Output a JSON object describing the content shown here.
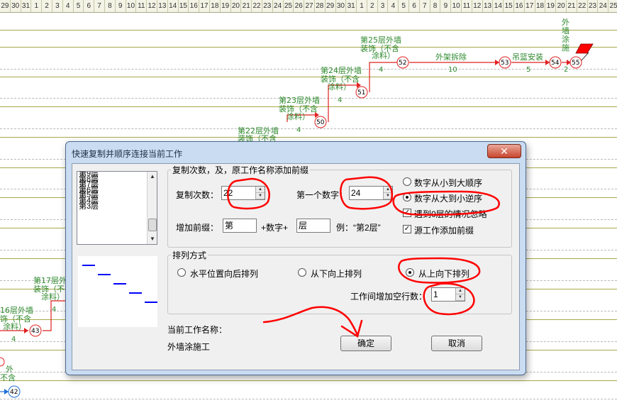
{
  "ruler": {
    "ticks": [
      "29",
      "30",
      "31",
      "1",
      "2",
      "3",
      "4",
      "5",
      "6",
      "7",
      "8",
      "9",
      "10",
      "11",
      "12",
      "13",
      "14",
      "15",
      "16",
      "17",
      "18",
      "19",
      "20",
      "21",
      "22",
      "23",
      "24",
      "25",
      "26",
      "27",
      "28",
      "29",
      "30",
      "31",
      "1",
      "2",
      "3",
      "4",
      "5",
      "6",
      "7",
      "8",
      "9",
      "10",
      "11",
      "12",
      "13",
      "14",
      "15",
      "16",
      "17",
      "18",
      "19",
      "20",
      "21",
      "22",
      "23",
      "24",
      "25",
      "26"
    ]
  },
  "network": {
    "nodes": [
      {
        "id": "n42",
        "label": "42",
        "color": "#1e6fd8"
      },
      {
        "id": "n43",
        "label": "43",
        "color": "#e02020"
      },
      {
        "id": "n50",
        "label": "50",
        "color": "#e02020"
      },
      {
        "id": "n51",
        "label": "51",
        "color": "#e02020"
      },
      {
        "id": "n52",
        "label": "52",
        "color": "#e02020"
      },
      {
        "id": "n53",
        "label": "53",
        "color": "#e02020"
      },
      {
        "id": "n54",
        "label": "54",
        "color": "#e02020"
      },
      {
        "id": "n55",
        "label": "55",
        "color": "#e02020"
      }
    ],
    "annotations": {
      "a25_l1": "第25层外墙",
      "a25_l2": "装饰（不含",
      "a25_l3": "涂料）",
      "a24_l1": "第24层外墙",
      "a24_l2": "装饰（不含",
      "a24_l3": "涂料）",
      "a23_l1": "第23层外墙",
      "a23_l2": "装饰（不含",
      "a23_l3": "涂料）",
      "a22_l1": "第22层外墙",
      "a22_l2": "装饰（不含",
      "a17_l1": "第17层外",
      "a17_l2": "装饰（不",
      "a17_l3": "涂料）",
      "a16_l1": "16层外墙",
      "a16_l2": "饰（不含",
      "a16_l3": "涂料）",
      "a_bottom_l1": "外",
      "a_bottom_l2": "不含",
      "scaffold": "外架拆除",
      "basket": "吊篮安装",
      "paint_v1": "外",
      "paint_v2": "墙",
      "paint_v3": "涂",
      "paint_v4": "施"
    },
    "durations": {
      "d52": "4",
      "d51": "4",
      "d50": "4",
      "d_scaffold": "10",
      "d_basket": "5",
      "d_paint": "2",
      "d17": "4",
      "d16": "4"
    }
  },
  "dialog": {
    "title": "快速复制并顺序连接当前工作",
    "close_label": "✕",
    "layer_list": [
      "第9层",
      "第8层",
      "第7层",
      "第6层",
      "第5层",
      "第4层",
      "第3层"
    ],
    "copy_group": {
      "legend": "复制次数，及，原工作名称添加前缀",
      "count_label": "复制次数：",
      "count_value": "22",
      "first_num_label": "第一个数字：",
      "first_num_value": "24",
      "prefix_label": "增加前缀：",
      "prefix_value": "第",
      "plus_num_label": "+数字+",
      "suffix_value": "层",
      "example_label": "例：“第2层”",
      "order_asc": "数字从小到大顺序",
      "order_desc": "数字从大到小逆序",
      "skip_zero": "遇到0层的情况忽略",
      "add_prefix_src": "源工作添加前缀"
    },
    "arrange_group": {
      "legend": "排列方式",
      "opt_horizontal": "水平位置向后排列",
      "opt_bottom_up": "从下向上排列",
      "opt_top_down": "从上向下排列",
      "gap_label": "工作间增加空行数：",
      "gap_value": "1"
    },
    "current_work_label": "当前工作名称：",
    "current_work_value": "外墙涂施工",
    "ok_label": "确定",
    "cancel_label": "取消"
  },
  "colors": {
    "node_red": "#e02020",
    "node_blue": "#1e6fd8",
    "annotation_green": "#2f8a2f",
    "marker_red": "#ff0000",
    "dialog_frame": "#c9dcf1"
  }
}
